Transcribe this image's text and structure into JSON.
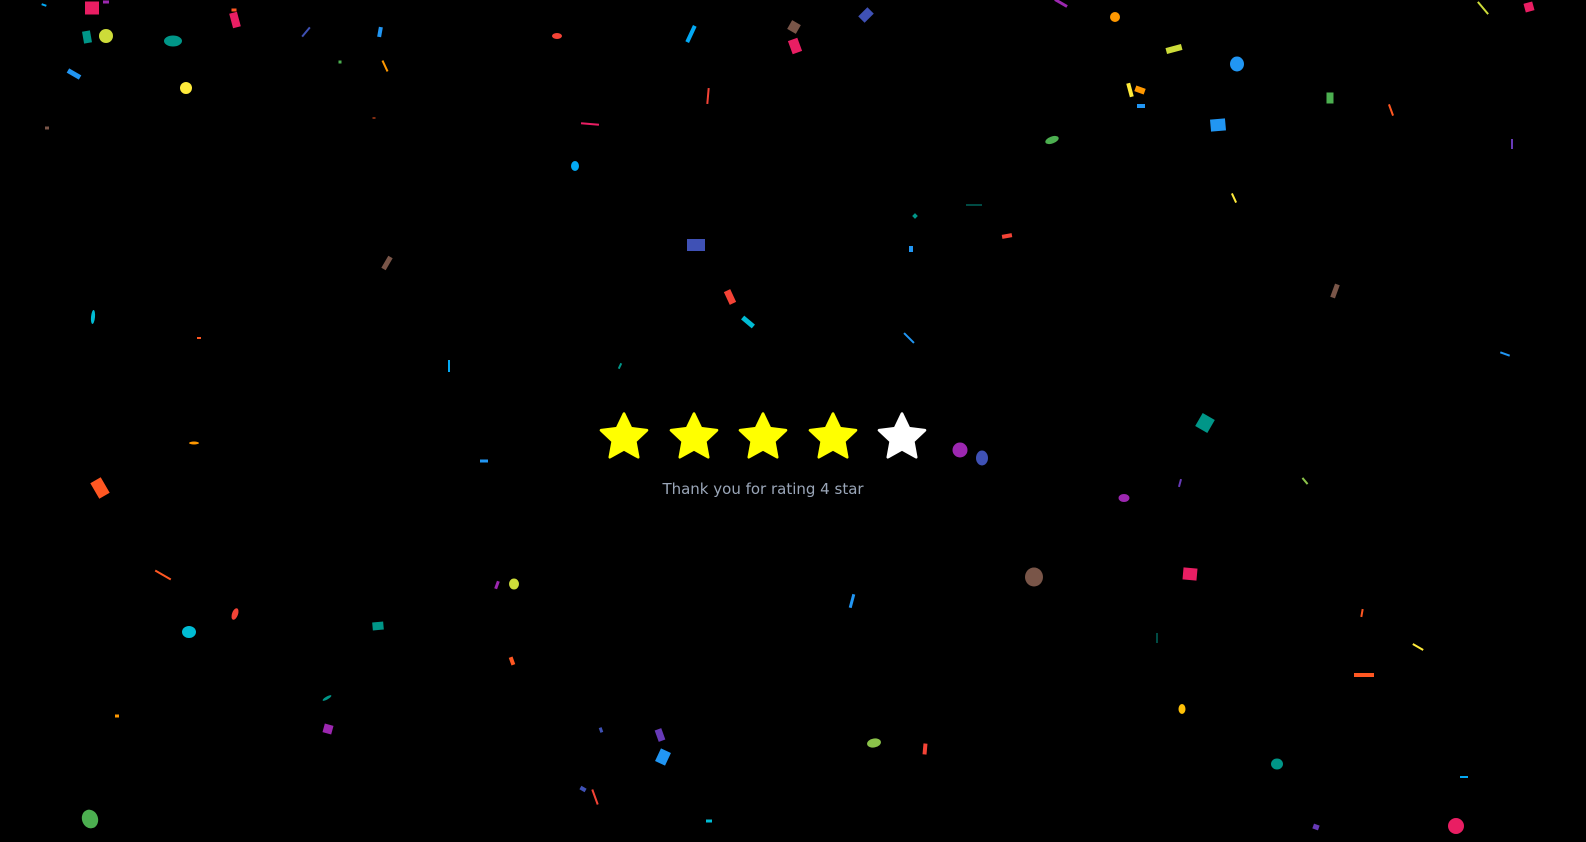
{
  "rating": {
    "max_stars": 5,
    "selected": 4,
    "star_icons": [
      "star-icon",
      "star-icon",
      "star-icon",
      "star-icon",
      "star-icon"
    ],
    "filled_color": "#ffff00",
    "empty_color": "#ffffff",
    "message": "Thank you for rating 4 star"
  },
  "background_color": "#000000",
  "confetti_palette": [
    "#e91e63",
    "#2196f3",
    "#ffeb3b",
    "#009688",
    "#f44336",
    "#795548",
    "#3f51b5",
    "#ff9800",
    "#4caf50",
    "#9c27b0",
    "#03a9f4",
    "#cddc39",
    "#ff5722",
    "#00bcd4",
    "#673ab7",
    "#ffc107",
    "#8bc34a"
  ]
}
